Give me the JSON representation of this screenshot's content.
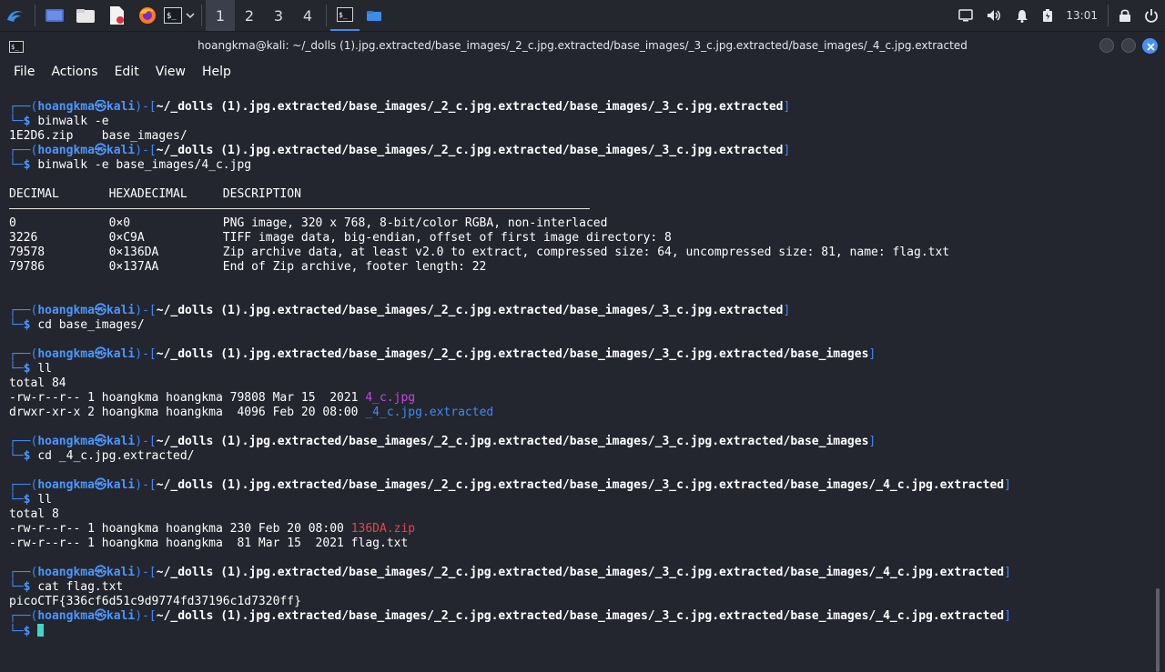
{
  "taskbar": {
    "workspaces": [
      "1",
      "2",
      "3",
      "4"
    ],
    "active_workspace": 0,
    "clock": "13:01"
  },
  "window": {
    "title": "hoangkma@kali: ~/_dolls (1).jpg.extracted/base_images/_2_c.jpg.extracted/base_images/_3_c.jpg.extracted/base_images/_4_c.jpg.extracted",
    "menu": [
      "File",
      "Actions",
      "Edit",
      "View",
      "Help"
    ]
  },
  "prompt": {
    "user": "hoangkma",
    "at": "㉿",
    "host": "kali",
    "dollar": "$"
  },
  "paths": {
    "p3": "~/_dolls (1).jpg.extracted/base_images/_2_c.jpg.extracted/base_images/_3_c.jpg.extracted",
    "p3b": "~/_dolls (1).jpg.extracted/base_images/_2_c.jpg.extracted/base_images/_3_c.jpg.extracted/base_images",
    "p4": "~/_dolls (1).jpg.extracted/base_images/_2_c.jpg.extracted/base_images/_3_c.jpg.extracted/base_images/_4_c.jpg.extracted"
  },
  "commands": {
    "c1": "binwalk -e",
    "c2": "binwalk -e base_images/4_c.jpg",
    "c3": "cd base_images/",
    "c4": "ll",
    "c5": "cd _4_c.jpg.extracted/",
    "c6": "ll",
    "c7": "cat flag.txt"
  },
  "output": {
    "o1": "1E2D6.zip    base_images/",
    "binwalk_header": "DECIMAL       HEXADECIMAL     DESCRIPTION",
    "binwalk_rows": [
      "0             0×0             PNG image, 320 x 768, 8-bit/color RGBA, non-interlaced",
      "3226          0×C9A           TIFF image data, big-endian, offset of first image directory: 8",
      "79578         0×136DA         Zip archive data, at least v2.0 to extract, compressed size: 64, uncompressed size: 81, name: flag.txt",
      "79786         0×137AA         End of Zip archive, footer length: 22"
    ],
    "ll1_total": "total 84",
    "ll1_row1_prefix": "-rw-r--r-- 1 hoangkma hoangkma 79808 Mar 15  2021 ",
    "ll1_row1_name": "4_c.jpg",
    "ll1_row2_prefix": "drwxr-xr-x 2 hoangkma hoangkma  4096 Feb 20 08:00 ",
    "ll1_row2_name": "_4_c.jpg.extracted",
    "ll2_total": "total 8",
    "ll2_row1_prefix": "-rw-r--r-- 1 hoangkma hoangkma 230 Feb 20 08:00 ",
    "ll2_row1_name": "136DA.zip",
    "ll2_row2": "-rw-r--r-- 1 hoangkma hoangkma  81 Mar 15  2021 flag.txt",
    "flag": "picoCTF{336cf6d51c9d9774fd37196c1d7320ff}"
  },
  "colors": {
    "prompt_blue": "#3d8af7",
    "image_file": "#c447e8",
    "archive_file": "#e84444",
    "cursor": "#3ed6c5"
  }
}
